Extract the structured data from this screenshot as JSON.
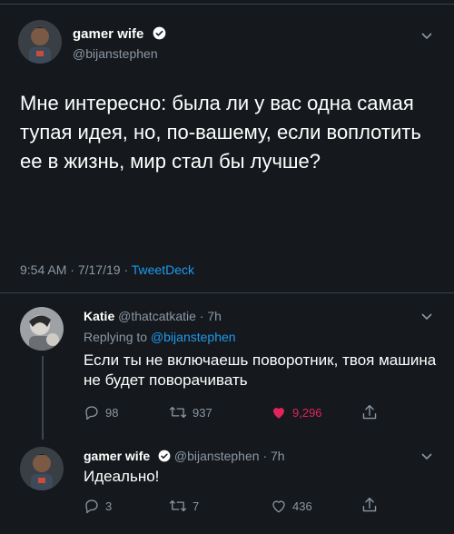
{
  "main_tweet": {
    "display_name": "gamer wife",
    "handle": "@bijanstephen",
    "text": "Мне интересно: была ли у вас одна самая тупая идея, но, по-вашему, если воплотить ее в жизнь, мир стал бы лучше?",
    "time": "9:54 AM",
    "date": "7/17/19",
    "source": "TweetDeck",
    "sep": "·"
  },
  "reply1": {
    "display_name": "Katie",
    "handle": "@thatcatkatie",
    "age": "· 7h",
    "replying_prefix": "Replying to",
    "replying_handle": "@bijanstephen",
    "text": "Если ты не включаешь поворотник, твоя машина не будет поворачивать",
    "reply_count": "98",
    "retweet_count": "937",
    "like_count": "9,296"
  },
  "reply2": {
    "display_name": "gamer wife",
    "handle": "@bijanstephen",
    "age": "· 7h",
    "text": "Идеально!",
    "reply_count": "3",
    "retweet_count": "7",
    "like_count": "436"
  },
  "colors": {
    "background": "#15181c",
    "muted": "#8b98a5",
    "link": "#1d9bf0",
    "like": "#e0245e",
    "verified": "#ffffff"
  }
}
